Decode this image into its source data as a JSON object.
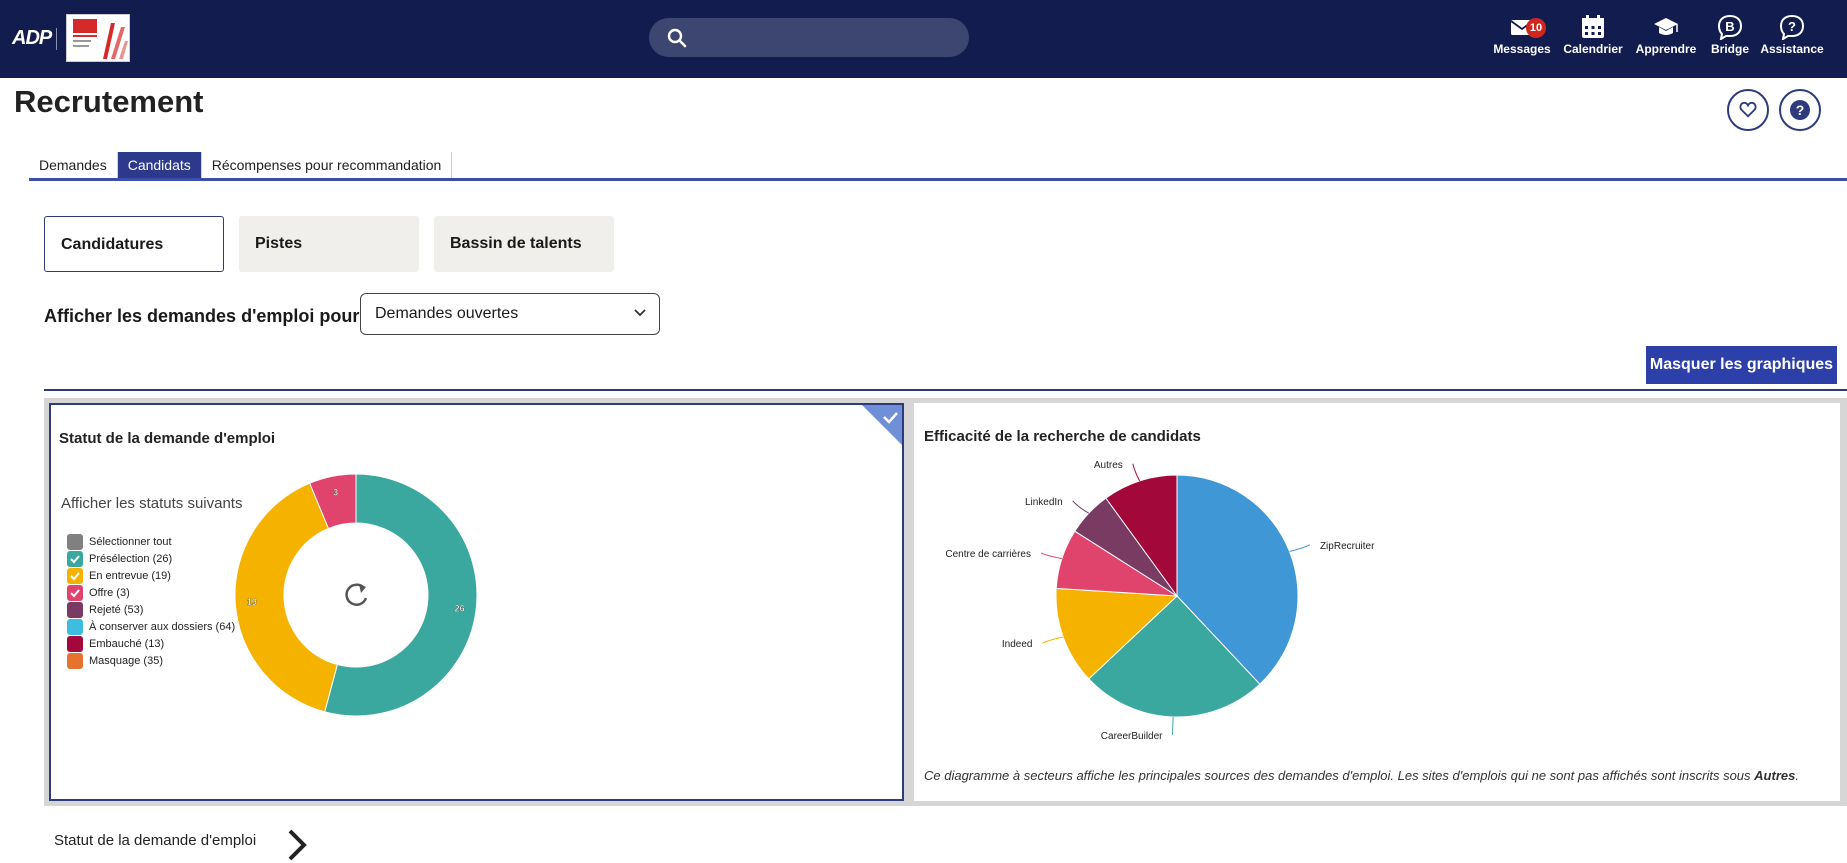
{
  "topbar": {
    "logo_text": "ADP",
    "search": {
      "placeholder": "",
      "value": ""
    },
    "nav": [
      {
        "label": "Messages",
        "badge": "10",
        "icon": "mail-icon"
      },
      {
        "label": "Calendrier",
        "icon": "calendar-icon"
      },
      {
        "label": "Apprendre",
        "icon": "graduation-cap-icon"
      },
      {
        "label": "Bridge",
        "icon": "bridge-icon"
      },
      {
        "label": "Assistance",
        "icon": "help-bubble-icon"
      }
    ]
  },
  "page": {
    "title": "Recrutement",
    "favorite_icon": "heart-icon",
    "help_icon": "question-icon"
  },
  "tabs": [
    {
      "label": "Demandes",
      "active": false
    },
    {
      "label": "Candidats",
      "active": true
    },
    {
      "label": "Récompenses pour recommandation",
      "active": false
    }
  ],
  "modes": [
    {
      "label": "Candidatures",
      "active": true
    },
    {
      "label": "Pistes",
      "active": false
    },
    {
      "label": "Bassin de talents",
      "active": false
    }
  ],
  "filter": {
    "label": "Afficher les demandes d'emploi pour",
    "selected": "Demandes ouvertes"
  },
  "hide_charts_button": "Masquer les graphiques",
  "status_panel": {
    "title": "Statut de la demande d'emploi",
    "legend_title": "Afficher les statuts suivants",
    "legend": [
      {
        "label": "Sélectionner tout",
        "color": "#808080",
        "checked": false
      },
      {
        "label": "Présélection (26)",
        "color": "#3ba8a0",
        "checked": true
      },
      {
        "label": "En entrevue (19)",
        "color": "#f5b300",
        "checked": true
      },
      {
        "label": "Offre (3)",
        "color": "#e0436b",
        "checked": true
      },
      {
        "label": "Rejeté (53)",
        "color": "#7a3b63",
        "checked": false
      },
      {
        "label": "À conserver aux dossiers (64)",
        "color": "#3fbde0",
        "checked": false
      },
      {
        "label": "Embauché (13)",
        "color": "#a3083b",
        "checked": false
      },
      {
        "label": "Masquage (35)",
        "color": "#e5732e",
        "checked": false
      }
    ],
    "reset_icon": "refresh-icon"
  },
  "sources_panel": {
    "title": "Efficacité de la recherche de candidats",
    "note_main": "Ce diagramme à secteurs affiche les principales sources des demandes d'emploi. Les sites d'emplois qui ne sont pas affichés sont inscrits sous ",
    "note_bold": "Autres",
    "note_end": "."
  },
  "chart_data": [
    {
      "type": "pie",
      "variant": "donut",
      "title": "Statut de la demande d'emploi",
      "categories": [
        "Présélection",
        "En entrevue",
        "Offre"
      ],
      "values": [
        26,
        19,
        3
      ],
      "colors": [
        "#3ba8a0",
        "#f5b300",
        "#e0436b"
      ],
      "data_labels": [
        "26",
        "19",
        "3"
      ]
    },
    {
      "type": "pie",
      "title": "Efficacité de la recherche de candidats",
      "categories": [
        "ZipRecruiter",
        "CareerBuilder",
        "Indeed",
        "Centre de carrières",
        "LinkedIn",
        "Autres"
      ],
      "values": [
        38,
        25,
        13,
        8,
        6,
        10
      ],
      "colors": [
        "#3f97d6",
        "#3ba8a0",
        "#f5b300",
        "#e0436b",
        "#7a3b63",
        "#a3083b"
      ]
    }
  ],
  "bottom_link": "Statut de la demande d'emploi"
}
